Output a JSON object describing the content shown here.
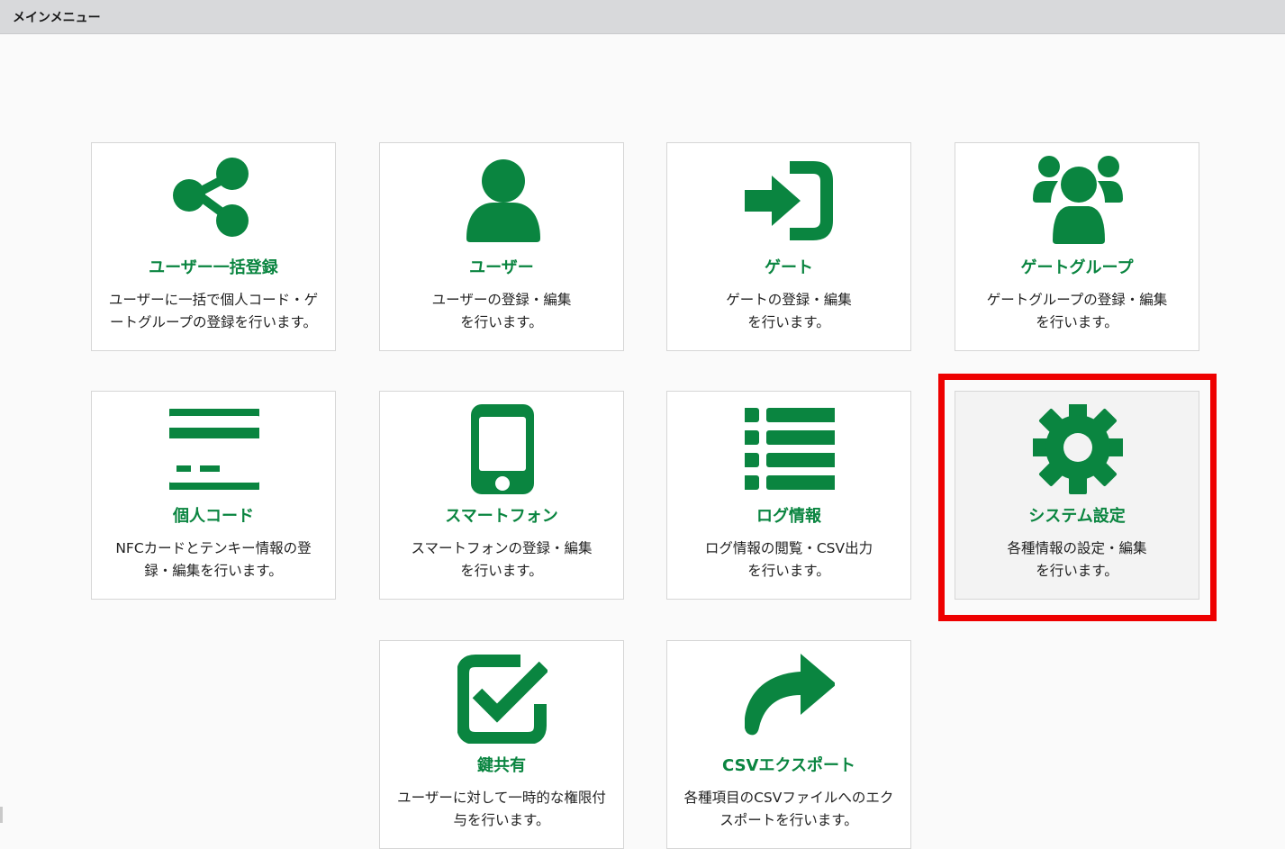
{
  "window": {
    "title": "メインメニュー"
  },
  "accent_color": "#0a8540",
  "highlight_color": "#ee0000",
  "tiles": [
    {
      "icon": "share-icon",
      "label": "ユーザー一括登録",
      "desc": [
        "ユーザーに一括で個人コード・ゲ",
        "ートグループの登録を行います。"
      ]
    },
    {
      "icon": "user-icon",
      "label": "ユーザー",
      "desc": [
        "ユーザーの登録・編集",
        "を行います。"
      ]
    },
    {
      "icon": "sign-in-icon",
      "label": "ゲート",
      "desc": [
        "ゲートの登録・編集",
        "を行います。"
      ]
    },
    {
      "icon": "users-icon",
      "label": "ゲートグループ",
      "desc": [
        "ゲートグループの登録・編集",
        "を行います。"
      ]
    },
    {
      "icon": "credit-card-icon",
      "label": "個人コード",
      "desc": [
        "NFCカードとテンキー情報の登",
        "録・編集を行います。"
      ]
    },
    {
      "icon": "mobile-phone-icon",
      "label": "スマートフォン",
      "desc": [
        "スマートフォンの登録・編集",
        "を行います。"
      ]
    },
    {
      "icon": "list-icon",
      "label": "ログ情報",
      "desc": [
        "ログ情報の閲覧・CSV出力",
        "を行います。"
      ]
    },
    {
      "icon": "gear-icon",
      "label": "システム設定",
      "desc": [
        "各種情報の設定・編集",
        "を行います。"
      ]
    },
    {
      "icon": "checkbox-icon",
      "label": "鍵共有",
      "desc": [
        "ユーザーに対して一時的な権限付",
        "与を行います。"
      ]
    },
    {
      "icon": "share-arrow-icon",
      "label": "CSVエクスポート",
      "desc": [
        "各種項目のCSVファイルへのエク",
        "スポートを行います。"
      ]
    }
  ]
}
